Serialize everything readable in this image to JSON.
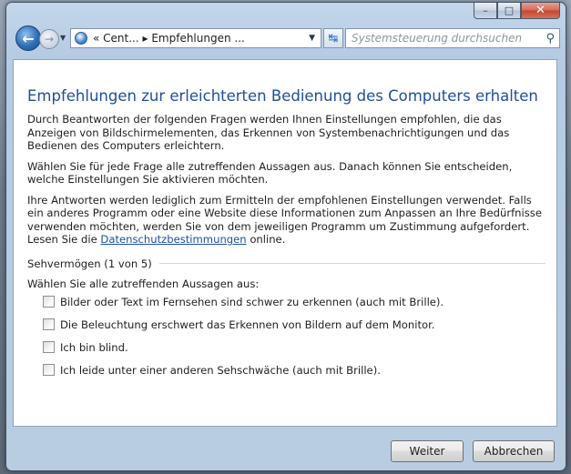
{
  "window": {
    "caption": {
      "minimize": "–",
      "maximize": "□",
      "close": "✕"
    }
  },
  "nav": {
    "back_icon": "←",
    "forward_icon": "→",
    "recent_icon": "▼",
    "address_text": "« Cent... ▸ Empfehlungen ...",
    "address_dropdown": "▼",
    "refresh_icon": "↹",
    "search_placeholder": "Systemsteuerung durchsuchen",
    "search_icon": "⚲"
  },
  "content": {
    "title": "Empfehlungen zur erleichterten Bedienung des Computers erhalten",
    "para1": "Durch Beantworten der folgenden Fragen werden Ihnen Einstellungen empfohlen, die das Anzeigen von Bildschirmelementen, das Erkennen von Systembenachrichtigungen und das Bedienen des Computers erleichtern.",
    "para2": "Wählen Sie für jede Frage alle zutreffenden Aussagen aus. Danach können Sie entscheiden, welche Einstellungen Sie aktivieren möchten.",
    "para3_pre": "Ihre Antworten werden lediglich zum Ermitteln der empfohlenen Einstellungen verwendet. Falls ein anderes Programm oder eine Website diese Informationen zum Anpassen an Ihre Bedürfnisse verwenden möchten, werden Sie von dem jeweiligen Programm um Zustimmung aufgefordert. Lesen Sie die ",
    "para3_link": "Datenschutzbestimmungen",
    "para3_post": " online.",
    "section_title": "Sehvermögen (1 von 5)",
    "choose_label": "Wählen Sie alle zutreffenden Aussagen aus:",
    "options": [
      "Bilder oder Text im Fernsehen sind schwer zu erkennen (auch mit Brille).",
      "Die Beleuchtung erschwert das Erkennen von Bildern auf dem Monitor.",
      "Ich bin blind.",
      "Ich leide unter einer anderen Sehschwäche (auch mit Brille)."
    ]
  },
  "footer": {
    "next_label": "Weiter",
    "cancel_label": "Abbrechen"
  }
}
